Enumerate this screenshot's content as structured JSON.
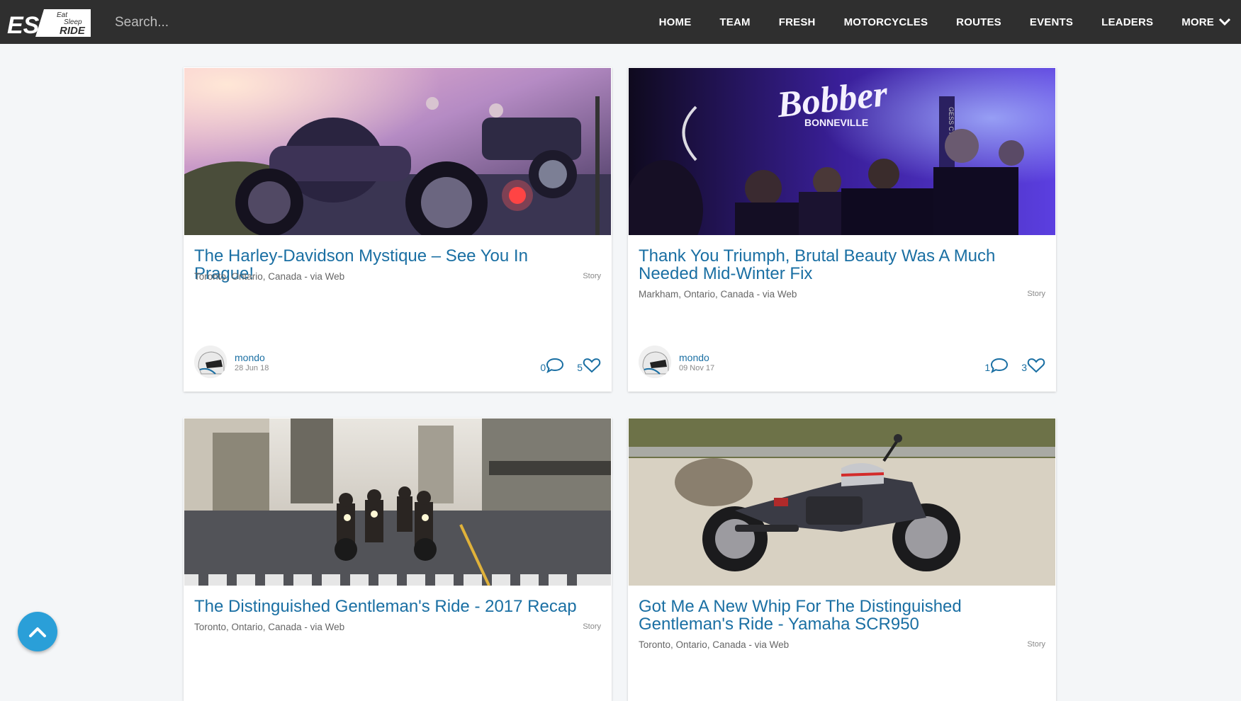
{
  "header": {
    "logo_text": "ESR",
    "logo_tagline_1": "Eat",
    "logo_tagline_2": "Sleep",
    "logo_tagline_3": "RIDE",
    "search_placeholder": "Search...",
    "nav": [
      "HOME",
      "TEAM",
      "FRESH",
      "MOTORCYCLES",
      "ROUTES",
      "EVENTS",
      "LEADERS"
    ],
    "more_label": "MORE"
  },
  "sign_texts": {
    "bobber": "Bobber",
    "bonneville": "BONNEVILLE",
    "banner": "GESS CYCLE"
  },
  "cards": [
    {
      "title": "The Harley-Davidson Mystique – See You In Prague!",
      "location": "Toronto, Ontario, Canada - via Web",
      "type": "Story",
      "author": "mondo",
      "date": "28 Jun 18",
      "comments": "0",
      "likes": "5"
    },
    {
      "title": "Thank You Triumph, Brutal Beauty Was A Much Needed Mid-Winter Fix",
      "location": "Markham, Ontario, Canada - via Web",
      "type": "Story",
      "author": "mondo",
      "date": "09 Nov 17",
      "comments": "1",
      "likes": "3"
    },
    {
      "title": "The Distinguished Gentleman's Ride - 2017 Recap",
      "location": "Toronto, Ontario, Canada - via Web",
      "type": "Story"
    },
    {
      "title": "Got Me A New Whip For The Distinguished Gentleman's Ride - Yamaha SCR950",
      "location": "Toronto, Ontario, Canada - via Web",
      "type": "Story"
    }
  ],
  "colors": {
    "topbar": "#2f2f2f",
    "link": "#1a6fa3",
    "accent": "#2a9fd8",
    "page_bg": "#f4f6f8"
  },
  "icons": {
    "comment": "comment-bubble-icon",
    "like": "heart-icon",
    "more": "chevron-down-icon",
    "scroll_top": "chevron-up-icon"
  }
}
